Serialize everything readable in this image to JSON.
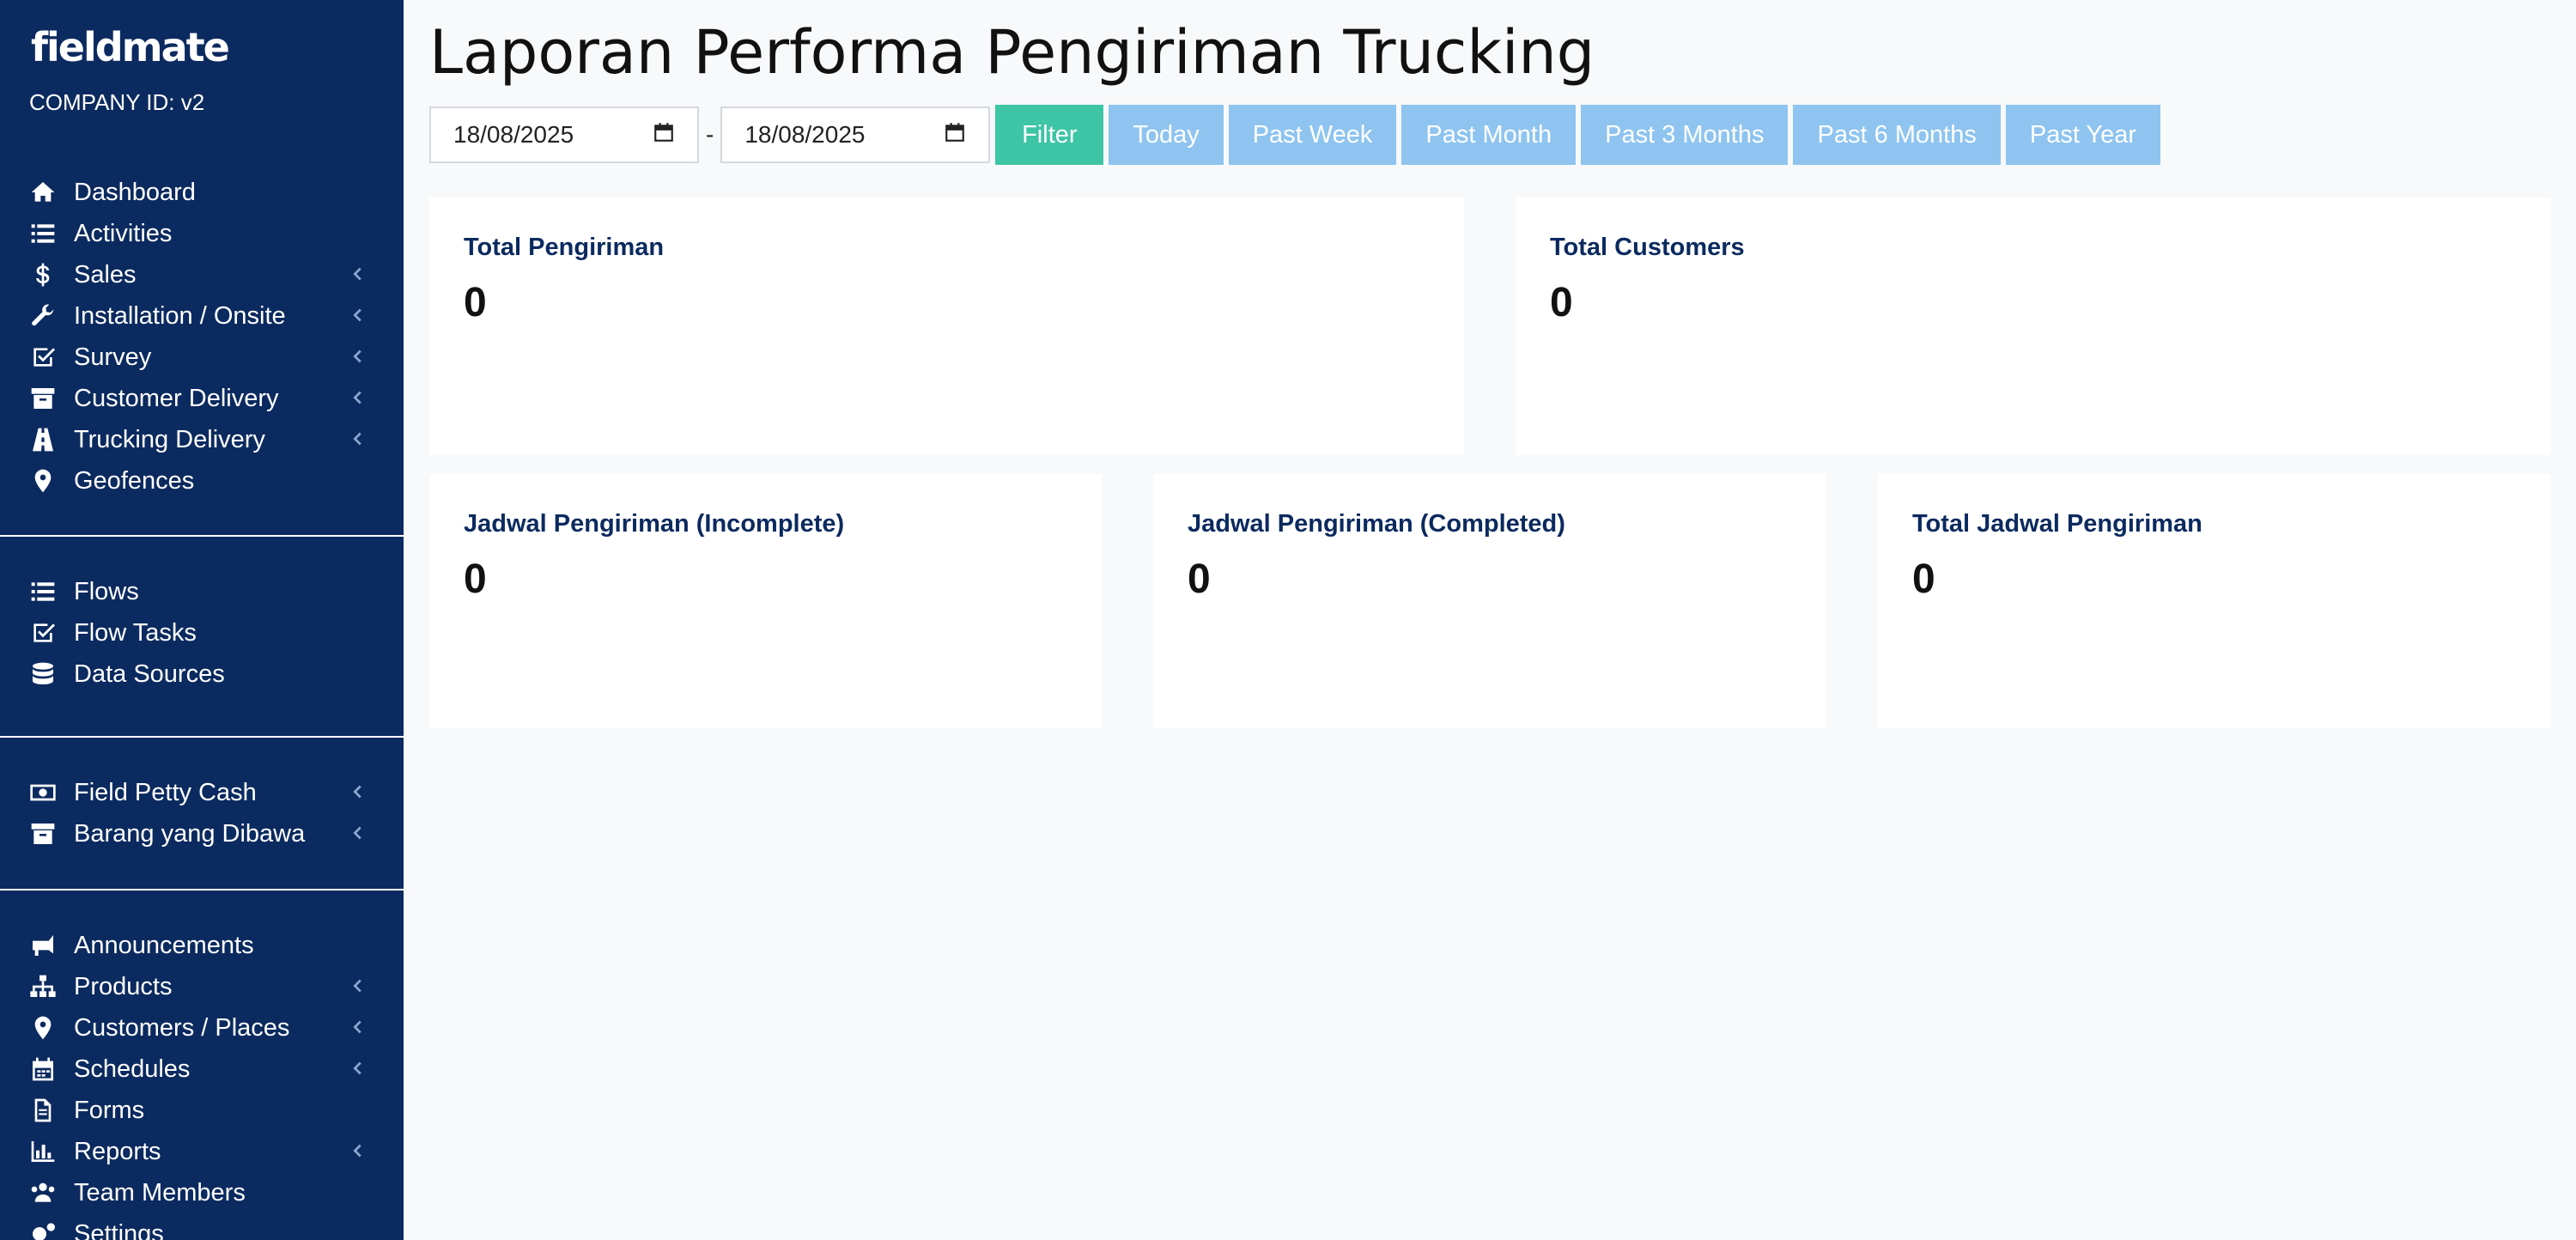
{
  "app": {
    "logo": "fieldmate",
    "company_id": "COMPANY ID: v2"
  },
  "sidebar": {
    "group1": [
      {
        "label": "Dashboard",
        "icon": "home-icon",
        "chevron": false
      },
      {
        "label": "Activities",
        "icon": "list-icon",
        "chevron": false
      },
      {
        "label": "Sales",
        "icon": "dollar-icon",
        "chevron": true
      },
      {
        "label": "Installation / Onsite",
        "icon": "wrench-icon",
        "chevron": true
      },
      {
        "label": "Survey",
        "icon": "check-square-icon",
        "chevron": true
      },
      {
        "label": "Customer Delivery",
        "icon": "archive-icon",
        "chevron": true
      },
      {
        "label": "Trucking Delivery",
        "icon": "road-icon",
        "chevron": true
      },
      {
        "label": "Geofences",
        "icon": "map-marker-icon",
        "chevron": false
      }
    ],
    "group2": [
      {
        "label": "Flows",
        "icon": "list-icon",
        "chevron": false
      },
      {
        "label": "Flow Tasks",
        "icon": "check-square-icon",
        "chevron": false
      },
      {
        "label": "Data Sources",
        "icon": "database-icon",
        "chevron": false
      }
    ],
    "group3": [
      {
        "label": "Field Petty Cash",
        "icon": "money-icon",
        "chevron": true
      },
      {
        "label": "Barang yang Dibawa",
        "icon": "archive-icon",
        "chevron": true
      }
    ],
    "group4": [
      {
        "label": "Announcements",
        "icon": "bullhorn-icon",
        "chevron": false
      },
      {
        "label": "Products",
        "icon": "sitemap-icon",
        "chevron": true
      },
      {
        "label": "Customers / Places",
        "icon": "map-marker-icon",
        "chevron": true
      },
      {
        "label": "Schedules",
        "icon": "calendar-icon",
        "chevron": true
      },
      {
        "label": "Forms",
        "icon": "file-icon",
        "chevron": false
      },
      {
        "label": "Reports",
        "icon": "bar-chart-icon",
        "chevron": true
      },
      {
        "label": "Team Members",
        "icon": "users-icon",
        "chevron": false
      },
      {
        "label": "Settings",
        "icon": "gears-icon",
        "chevron": false
      }
    ]
  },
  "main": {
    "title": "Laporan Performa Pengiriman Trucking",
    "date_from": "18/08/2025",
    "date_separator": "-",
    "date_to": "18/08/2025",
    "filter_label": "Filter",
    "ranges": [
      "Today",
      "Past Week",
      "Past Month",
      "Past 3 Months",
      "Past 6 Months",
      "Past Year"
    ],
    "cards": [
      {
        "title": "Total Pengiriman",
        "value": "0"
      },
      {
        "title": "Total Customers",
        "value": "0"
      },
      {
        "title": "Jadwal Pengiriman (Incomplete)",
        "value": "0"
      },
      {
        "title": "Jadwal Pengiriman (Completed)",
        "value": "0"
      },
      {
        "title": "Total Jadwal Pengiriman",
        "value": "0"
      }
    ]
  },
  "colors": {
    "sidebar_bg": "#0b2a5f",
    "filter_button": "#3dc5a5",
    "range_button": "#8ec4ef",
    "card_title": "#0b2a5f"
  }
}
